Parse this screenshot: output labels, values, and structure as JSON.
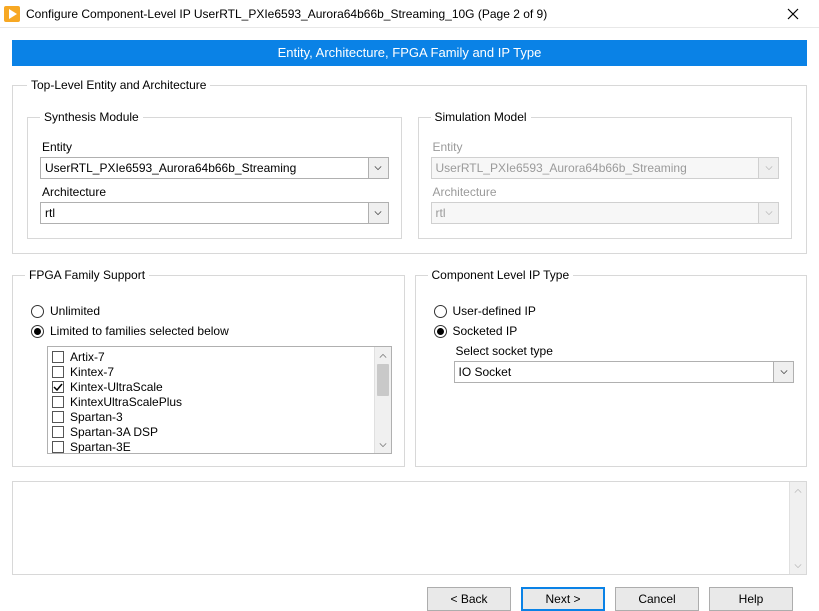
{
  "window": {
    "title": "Configure Component-Level IP UserRTL_PXIe6593_Aurora64b66b_Streaming_10G (Page 2 of 9)"
  },
  "banner": "Entity, Architecture, FPGA Family and IP Type",
  "top": {
    "legend": "Top-Level Entity and Architecture",
    "synth": {
      "legend": "Synthesis Module",
      "entity_label": "Entity",
      "entity_value": "UserRTL_PXIe6593_Aurora64b66b_Streaming",
      "arch_label": "Architecture",
      "arch_value": "rtl"
    },
    "sim": {
      "legend": "Simulation Model",
      "entity_label": "Entity",
      "entity_value": "UserRTL_PXIe6593_Aurora64b66b_Streaming",
      "arch_label": "Architecture",
      "arch_value": "rtl"
    }
  },
  "fpga": {
    "legend": "FPGA Family Support",
    "radio_unlimited": "Unlimited",
    "radio_limited": "Limited to families selected below",
    "families": [
      {
        "label": "Artix-7",
        "checked": false
      },
      {
        "label": "Kintex-7",
        "checked": false
      },
      {
        "label": "Kintex-UltraScale",
        "checked": true
      },
      {
        "label": "KintexUltraScalePlus",
        "checked": false
      },
      {
        "label": "Spartan-3",
        "checked": false
      },
      {
        "label": "Spartan-3A DSP",
        "checked": false
      },
      {
        "label": "Spartan-3E",
        "checked": false
      }
    ]
  },
  "clip": {
    "legend": "Component Level IP Type",
    "radio_user": "User-defined IP",
    "radio_socket": "Socketed IP",
    "socket_label": "Select socket type",
    "socket_value": "IO Socket"
  },
  "footer": {
    "back": "< Back",
    "next": "Next >",
    "cancel": "Cancel",
    "help": "Help"
  }
}
